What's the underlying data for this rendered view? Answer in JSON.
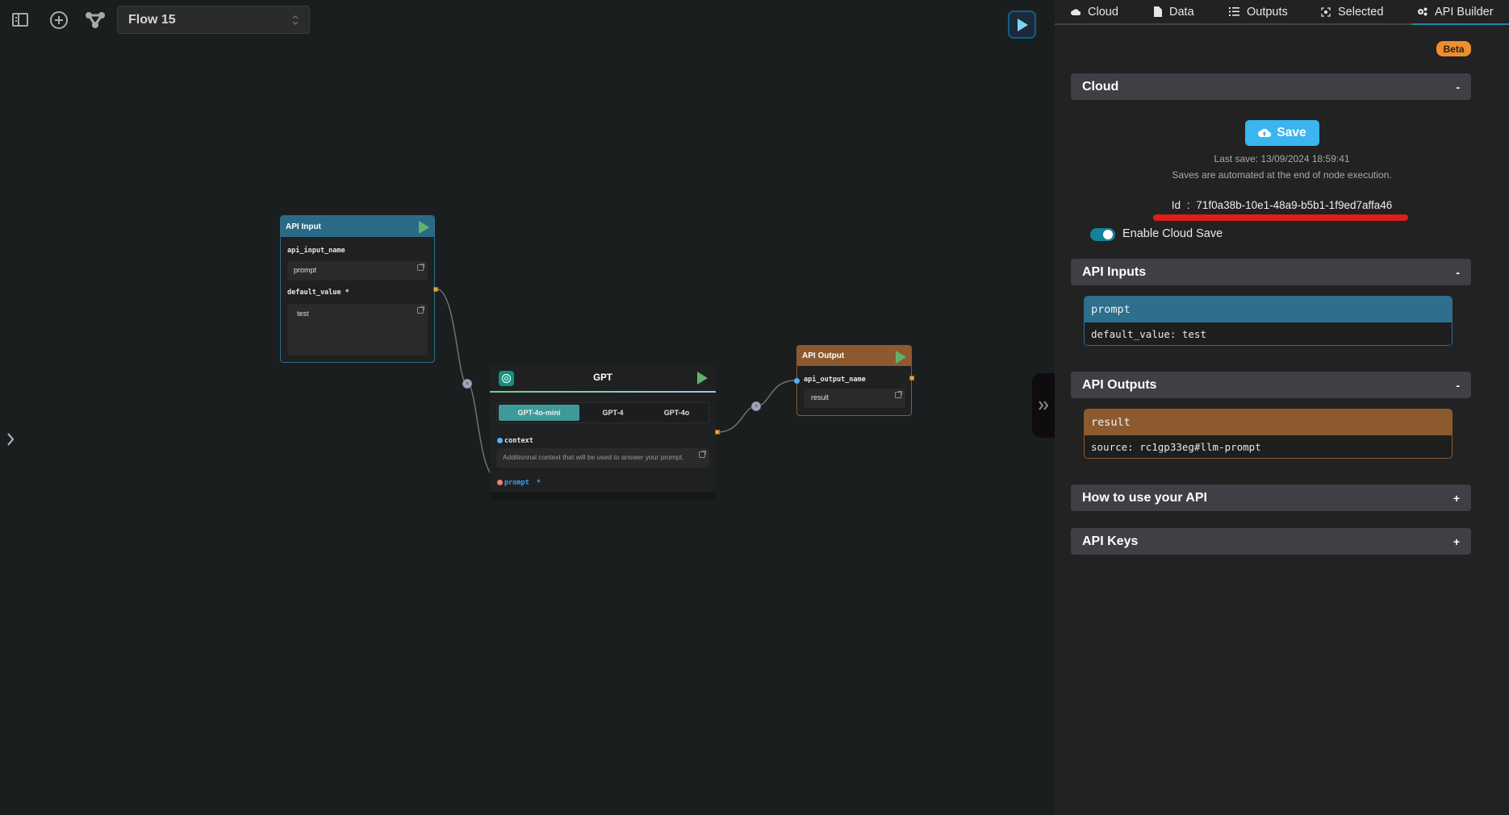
{
  "toolbar": {
    "sidebar_toggle_icon": "sidebar-panel-icon",
    "add_icon": "plus-circle-icon",
    "graph_icon": "share-graph-icon",
    "flow_select": {
      "value": "Flow 15"
    },
    "run_icon": "play-icon"
  },
  "canvas": {
    "nodes": {
      "api_input": {
        "title": "API Input",
        "fields": [
          {
            "label": "api_input_name",
            "value": "prompt"
          },
          {
            "label": "default_value *",
            "value": "test"
          }
        ]
      },
      "gpt": {
        "title": "GPT",
        "model_tabs": [
          "GPT-4o-mini",
          "GPT-4",
          "GPT-4o"
        ],
        "active_model": "GPT-4o-mini",
        "inputs": [
          {
            "label": "context",
            "placeholder": "Additionnal context that will be used to answer your prompt.",
            "color": "#5ab0ef"
          },
          {
            "label": "prompt",
            "required_mark": "*",
            "color": "#f08070"
          }
        ]
      },
      "api_output": {
        "title": "API Output",
        "fields": [
          {
            "label": "api_output_name",
            "value": "result"
          }
        ]
      }
    }
  },
  "panel": {
    "tabs": [
      {
        "label": "Cloud",
        "icon": "cloud-upload-icon"
      },
      {
        "label": "Data",
        "icon": "file-icon"
      },
      {
        "label": "Outputs",
        "icon": "list-icon"
      },
      {
        "label": "Selected",
        "icon": "target-icon"
      },
      {
        "label": "API Builder",
        "icon": "gears-icon",
        "active": true
      }
    ],
    "badge": "Beta",
    "sections": {
      "cloud": {
        "title": "Cloud",
        "toggle": "-",
        "save_label": "Save",
        "last_save": "Last save: 13/09/2024 18:59:41",
        "note": "Saves are automated at the end of node execution.",
        "id_label": "Id",
        "id_sep": ":",
        "id_value": "71f0a38b-10e1-48a9-b5b1-1f9ed7affa46",
        "enable_label": "Enable Cloud Save",
        "enable_checked": true
      },
      "api_inputs": {
        "title": "API Inputs",
        "toggle": "-",
        "items": [
          {
            "name": "prompt",
            "detail": "default_value:  test"
          }
        ]
      },
      "api_outputs": {
        "title": "API Outputs",
        "toggle": "-",
        "items": [
          {
            "name": "result",
            "detail": "source:  rc1gp33eg#llm-prompt"
          }
        ]
      },
      "how_to": {
        "title": "How to use your API",
        "toggle": "+"
      },
      "api_keys": {
        "title": "API Keys",
        "toggle": "+"
      }
    }
  },
  "colors": {
    "input_accent": "#2b6a87",
    "output_accent": "#8d5a2f",
    "save_button": "#3ab5f0",
    "beta_badge": "#f08d2d",
    "active_tab": "#1a8aa5",
    "highlight_underline": "#dd1c1c"
  }
}
